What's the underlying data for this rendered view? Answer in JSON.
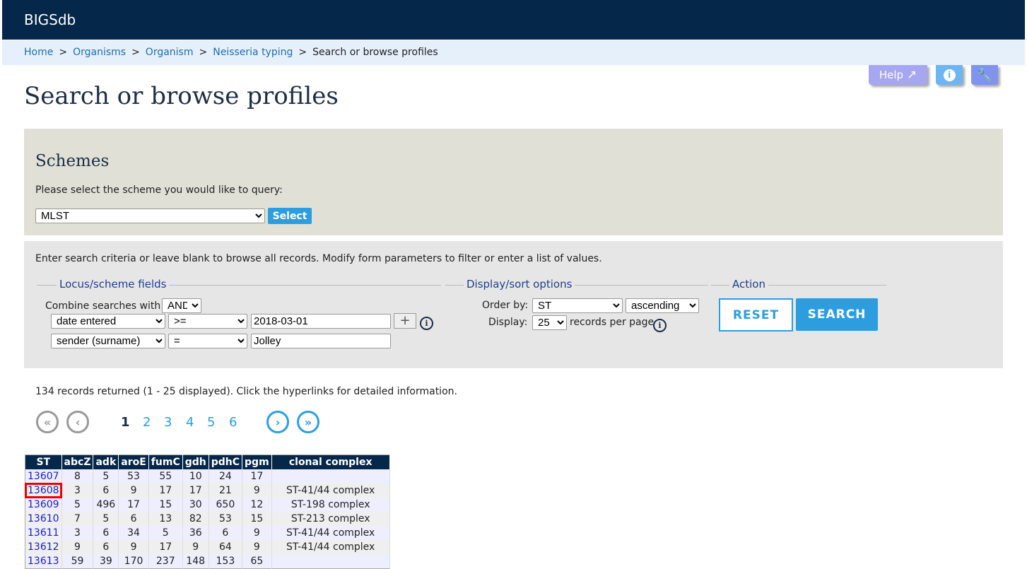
{
  "header": {
    "title": "BIGSdb"
  },
  "breadcrumb": [
    "Home",
    "Organisms",
    "Organism",
    "Neisseria typing"
  ],
  "breadcrumb_current": "Search or browse profiles",
  "toolbar": {
    "help_label": "Help",
    "colors": {
      "help": "#a7a6f0",
      "info": "#6db5f3",
      "tools": "#7f93ef"
    }
  },
  "page_title": "Search or browse profiles",
  "schemes": {
    "title": "Schemes",
    "prompt": "Please select the scheme you would like to query:",
    "selected": "MLST",
    "select_label": "Select"
  },
  "search": {
    "intro": "Enter search criteria or leave blank to browse all records. Modify form parameters to filter or enter a list of values.",
    "locus_legend": "Locus/scheme fields",
    "combine_label": "Combine searches with:",
    "combine_value": "AND",
    "rows": [
      {
        "field": "date entered",
        "op": ">=",
        "value": "2018-03-01"
      },
      {
        "field": "sender (surname)",
        "op": "=",
        "value": "Jolley"
      }
    ],
    "display_legend": "Display/sort options",
    "order_label": "Order by:",
    "order_value": "ST",
    "direction": "ascending",
    "display_label": "Display:",
    "display_value": "25",
    "per_page": "records per page",
    "action_legend": "Action",
    "reset_label": "RESET",
    "search_label": "SEARCH"
  },
  "results": {
    "summary": "134 records returned (1 - 25 displayed). Click the hyperlinks for detailed information.",
    "pages": [
      "1",
      "2",
      "3",
      "4",
      "5",
      "6"
    ],
    "current_page": "1",
    "columns": [
      "ST",
      "abcZ",
      "adk",
      "aroE",
      "fumC",
      "gdh",
      "pdhC",
      "pgm",
      "clonal complex"
    ],
    "rows": [
      [
        "13607",
        "8",
        "5",
        "53",
        "55",
        "10",
        "24",
        "17",
        ""
      ],
      [
        "13608",
        "3",
        "6",
        "9",
        "17",
        "17",
        "21",
        "9",
        "ST-41/44 complex"
      ],
      [
        "13609",
        "5",
        "496",
        "17",
        "15",
        "30",
        "650",
        "12",
        "ST-198 complex"
      ],
      [
        "13610",
        "7",
        "5",
        "6",
        "13",
        "82",
        "53",
        "15",
        "ST-213 complex"
      ],
      [
        "13611",
        "3",
        "6",
        "34",
        "5",
        "36",
        "6",
        "9",
        "ST-41/44 complex"
      ],
      [
        "13612",
        "9",
        "6",
        "9",
        "17",
        "9",
        "64",
        "9",
        "ST-41/44 complex"
      ],
      [
        "13613",
        "59",
        "39",
        "170",
        "237",
        "148",
        "153",
        "65",
        ""
      ]
    ],
    "highlighted": "13608"
  }
}
